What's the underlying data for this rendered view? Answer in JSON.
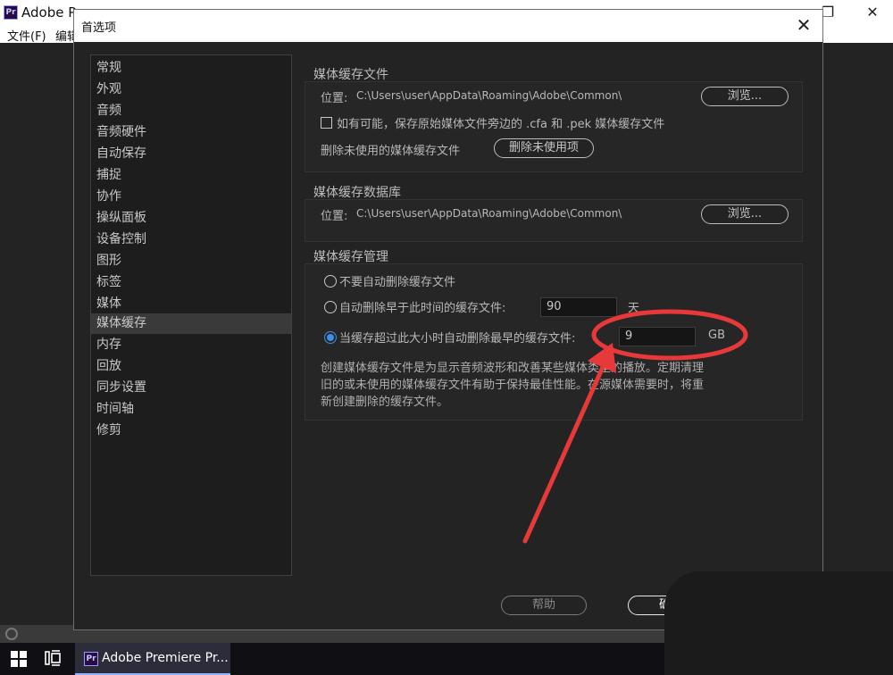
{
  "app": {
    "title": "Adobe Pr...",
    "logo_text": "Pr",
    "menu": [
      "文件(F)",
      "编辑"
    ],
    "window_controls": {
      "restore": "❐",
      "close": "✕"
    }
  },
  "dialog": {
    "title": "首选项",
    "close": "✕",
    "sidebar": {
      "items": [
        "常规",
        "外观",
        "音频",
        "音频硬件",
        "自动保存",
        "捕捉",
        "协作",
        "操纵面板",
        "设备控制",
        "图形",
        "标签",
        "媒体",
        "媒体缓存",
        "内存",
        "回放",
        "同步设置",
        "时间轴",
        "修剪"
      ],
      "selected": "媒体缓存"
    },
    "cache_files": {
      "title": "媒体缓存文件",
      "location_label": "位置:",
      "location_path": "C:\\Users\\user\\AppData\\Roaming\\Adobe\\Common\\",
      "browse": "浏览...",
      "checkbox_label": "如有可能，保存原始媒体文件旁边的 .cfa 和 .pek 媒体缓存文件",
      "checkbox_checked": false,
      "delete_label": "删除未使用的媒体缓存文件",
      "delete_button": "删除未使用项"
    },
    "cache_db": {
      "title": "媒体缓存数据库",
      "location_label": "位置:",
      "location_path": "C:\\Users\\user\\AppData\\Roaming\\Adobe\\Common\\",
      "browse": "浏览..."
    },
    "cache_mgmt": {
      "title": "媒体缓存管理",
      "option_none": "不要自动删除缓存文件",
      "option_age": "自动删除早于此时间的缓存文件:",
      "age_value": "90",
      "age_unit": "天",
      "option_size": "当缓存超过此大小时自动删除最早的缓存文件:",
      "size_value": "9",
      "size_unit": "GB",
      "selected_option": "size",
      "description": "创建媒体缓存文件是为显示音频波形和改善某些媒体类型的播放。定期清理旧的或未使用的媒体缓存文件有助于保持最佳性能。在源媒体需要时，将重新创建删除的缓存文件。"
    },
    "buttons": {
      "help": "帮助",
      "ok": "确定"
    }
  },
  "taskbar": {
    "app_label": "Adobe Premiere Pr...",
    "app_logo": "Pr"
  },
  "colors": {
    "accent": "#3d8ee8",
    "annotation_red": "#e8393a"
  }
}
